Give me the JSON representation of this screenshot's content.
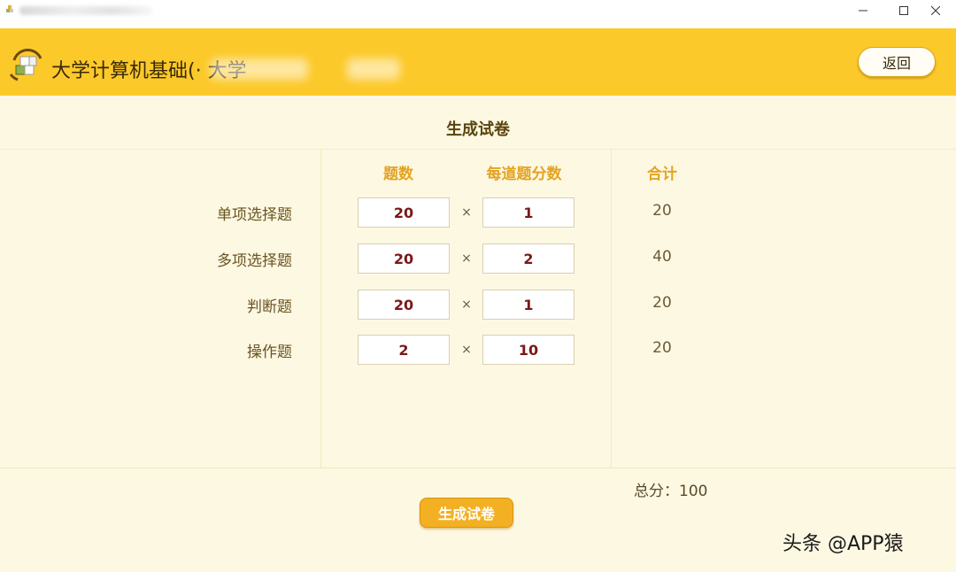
{
  "window": {
    "minimize_glyph": "—",
    "maximize_glyph": "☐",
    "close_glyph": "✕"
  },
  "header": {
    "app_title": "大学计算机基础(·           大学",
    "back_label": "返回",
    "accent_color": "#fcc92a"
  },
  "main": {
    "page_title": "生成试卷",
    "columns": {
      "count": "题数",
      "score_each": "每道题分数",
      "subtotal": "合计"
    },
    "times_sign": "×",
    "rows": [
      {
        "label": "单项选择题",
        "count": "20",
        "score": "1",
        "subtotal": "20"
      },
      {
        "label": "多项选择题",
        "count": "20",
        "score": "2",
        "subtotal": "40"
      },
      {
        "label": "判断题",
        "count": "20",
        "score": "1",
        "subtotal": "20"
      },
      {
        "label": "操作题",
        "count": "2",
        "score": "10",
        "subtotal": "20"
      }
    ],
    "total_text": "总分：100",
    "generate_label": "生成试卷"
  },
  "watermark": "头条 @APP猿",
  "icons": [
    "app-logo-icon",
    "minimize-icon",
    "maximize-icon",
    "close-icon"
  ]
}
